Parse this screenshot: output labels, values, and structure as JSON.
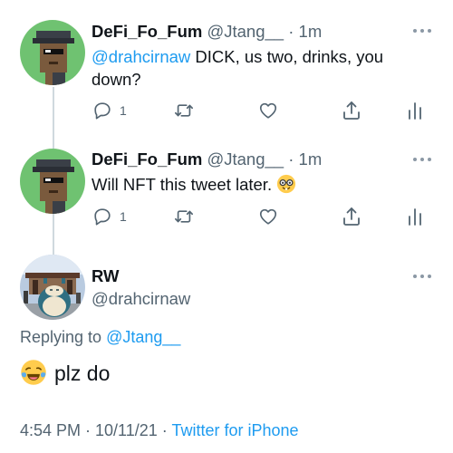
{
  "tweets": [
    {
      "name": "DeFi_Fo_Fum",
      "handle": "@Jtang__",
      "dot": "·",
      "time": "1m",
      "mention": "@drahcirnaw",
      "text": " DICK, us two, drinks, you down?",
      "reply_count": "1",
      "avatar_icon": "pixel-punk-avatar"
    },
    {
      "name": "DeFi_Fo_Fum",
      "handle": "@Jtang__",
      "dot": "·",
      "time": "1m",
      "text": "Will NFT this tweet later.",
      "emoji_icon": "nerd-face-emoji",
      "reply_count": "1",
      "avatar_icon": "pixel-punk-avatar"
    }
  ],
  "main_tweet": {
    "name": "RW",
    "handle": "@drahcirnaw",
    "replying_prefix": "Replying to",
    "replying_to": "@Jtang__",
    "emoji_icon": "tears-of-joy-emoji",
    "text": "plz do",
    "timestamp": "4:54 PM · 10/11/21",
    "dot": "·",
    "client": "Twitter for iPhone",
    "avatar_icon": "snorlax-photo-avatar"
  },
  "colors": {
    "link": "#1d9bf0",
    "secondary_text": "#536471",
    "primary_text": "#0f1419",
    "thread_line": "#cfd9de",
    "avatar_bg": "#6fc271"
  }
}
